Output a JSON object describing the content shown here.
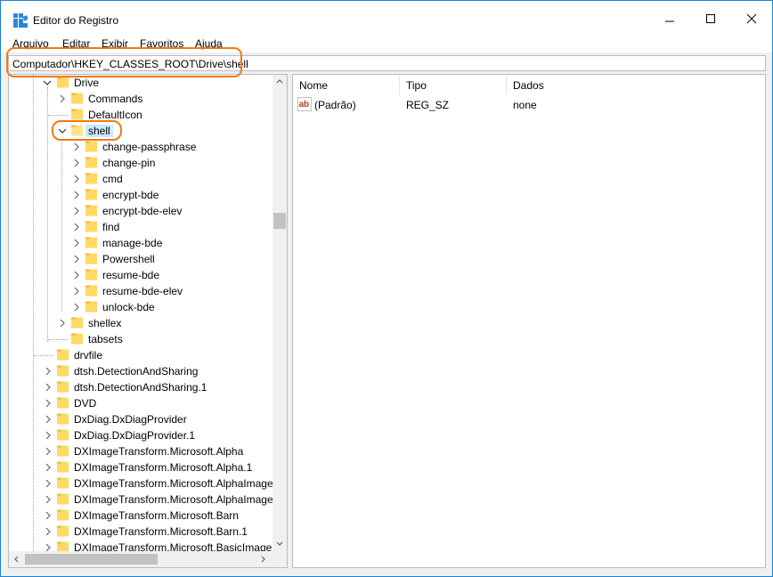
{
  "window": {
    "title": "Editor do Registro",
    "icon": "regedit-icon",
    "controls": [
      "minimize-icon",
      "maximize-icon",
      "close-icon"
    ]
  },
  "menu": [
    "Arquivo",
    "Editar",
    "Exibir",
    "Favoritos",
    "Ajuda"
  ],
  "address": "Computador\\HKEY_CLASSES_ROOT\\Drive\\shell",
  "tree": [
    {
      "label": "Drive",
      "expanded": true
    },
    {
      "label": "Commands"
    },
    {
      "label": "DefaultIcon"
    },
    {
      "label": "shell",
      "expanded": true,
      "selected": true
    },
    {
      "label": "change-passphrase"
    },
    {
      "label": "change-pin"
    },
    {
      "label": "cmd"
    },
    {
      "label": "encrypt-bde"
    },
    {
      "label": "encrypt-bde-elev"
    },
    {
      "label": "find"
    },
    {
      "label": "manage-bde"
    },
    {
      "label": "Powershell"
    },
    {
      "label": "resume-bde"
    },
    {
      "label": "resume-bde-elev"
    },
    {
      "label": "unlock-bde"
    },
    {
      "label": "shellex"
    },
    {
      "label": "tabsets"
    },
    {
      "label": "drvfile"
    },
    {
      "label": "dtsh.DetectionAndSharing"
    },
    {
      "label": "dtsh.DetectionAndSharing.1"
    },
    {
      "label": "DVD"
    },
    {
      "label": "DxDiag.DxDiagProvider"
    },
    {
      "label": "DxDiag.DxDiagProvider.1"
    },
    {
      "label": "DXImageTransform.Microsoft.Alpha"
    },
    {
      "label": "DXImageTransform.Microsoft.Alpha.1"
    },
    {
      "label": "DXImageTransform.Microsoft.AlphaImage"
    },
    {
      "label": "DXImageTransform.Microsoft.AlphaImage"
    },
    {
      "label": "DXImageTransform.Microsoft.Barn"
    },
    {
      "label": "DXImageTransform.Microsoft.Barn.1"
    },
    {
      "label": "DXImageTransform.Microsoft.BasicImage"
    }
  ],
  "list": {
    "columns": [
      "Nome",
      "Tipo",
      "Dados"
    ],
    "rows": [
      {
        "name": "(Padrão)",
        "type": "REG_SZ",
        "data": "none",
        "icon": "string-value-icon"
      }
    ]
  },
  "colors": {
    "highlight": "#f07a16",
    "selection": "#cce8ff",
    "folder": "#ffd966",
    "window_border": "#1883d7"
  }
}
